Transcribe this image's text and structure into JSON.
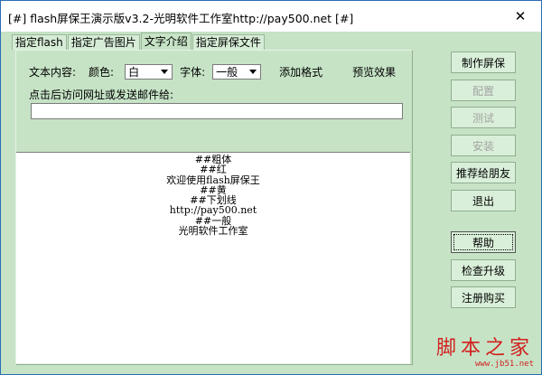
{
  "window": {
    "title": "[#] flash屏保王演示版v3.2-光明软件工作室http://pay500.net [#]",
    "close_glyph": "✕"
  },
  "tabs": [
    {
      "label": "指定flash"
    },
    {
      "label": "指定广告图片"
    },
    {
      "label": "文字介绍",
      "active": true
    },
    {
      "label": "指定屏保文件"
    }
  ],
  "panel": {
    "content_label": "文本内容:",
    "color_label": "颜色:",
    "color_value": "白",
    "font_label": "字体:",
    "font_value": "一般",
    "add_format": "添加格式",
    "preview_effect": "预览效果",
    "url_label": "点击后访问网址或发送邮件给:",
    "url_value": ""
  },
  "preview_lines": [
    "##粗体",
    "##红",
    "欢迎使用flash屏保王",
    "##黄",
    "##下划线",
    "http://pay500.net",
    "##一般",
    "光明软件工作室"
  ],
  "side_buttons": [
    {
      "label": "制作屏保",
      "enabled": true
    },
    {
      "label": "配置",
      "enabled": false
    },
    {
      "label": "测试",
      "enabled": false
    },
    {
      "label": "安装",
      "enabled": false
    },
    {
      "label": "推荐给朋友",
      "enabled": true
    },
    {
      "label": "退出",
      "enabled": true
    },
    {
      "label": "帮助",
      "enabled": true,
      "focused": true
    },
    {
      "label": "检查升级",
      "enabled": true
    },
    {
      "label": "注册购买",
      "enabled": true
    }
  ],
  "watermark": {
    "brand": "脚本之家",
    "url": "www.jb51.net"
  },
  "colors": {
    "background": "#c6e3c6",
    "accent": "#2b6cb3",
    "watermark": "#d2211f"
  }
}
